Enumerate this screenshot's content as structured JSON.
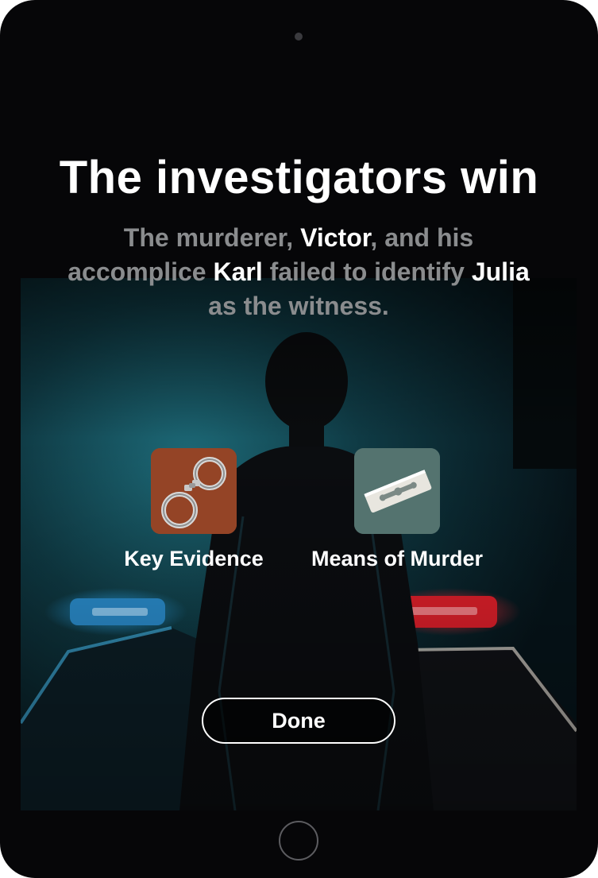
{
  "result": {
    "title": "The investigators win",
    "subtitle": {
      "part1": "The murderer, ",
      "murderer": "Victor",
      "part2": ", and his accomplice ",
      "accomplice": "Karl",
      "part3": " failed to identify ",
      "witness": "Julia",
      "part4": " as the witness."
    }
  },
  "cards": {
    "key_evidence": {
      "label": "Key Evidence",
      "icon": "handcuffs-icon"
    },
    "means_of_murder": {
      "label": "Means of Murder",
      "icon": "razor-blade-icon"
    }
  },
  "actions": {
    "done_label": "Done"
  },
  "colors": {
    "device": "#060608",
    "police_blue": "#1f8fd6",
    "police_red": "#e0202a",
    "evidence_card": "#a14c2c",
    "means_card": "#4b6a66"
  }
}
